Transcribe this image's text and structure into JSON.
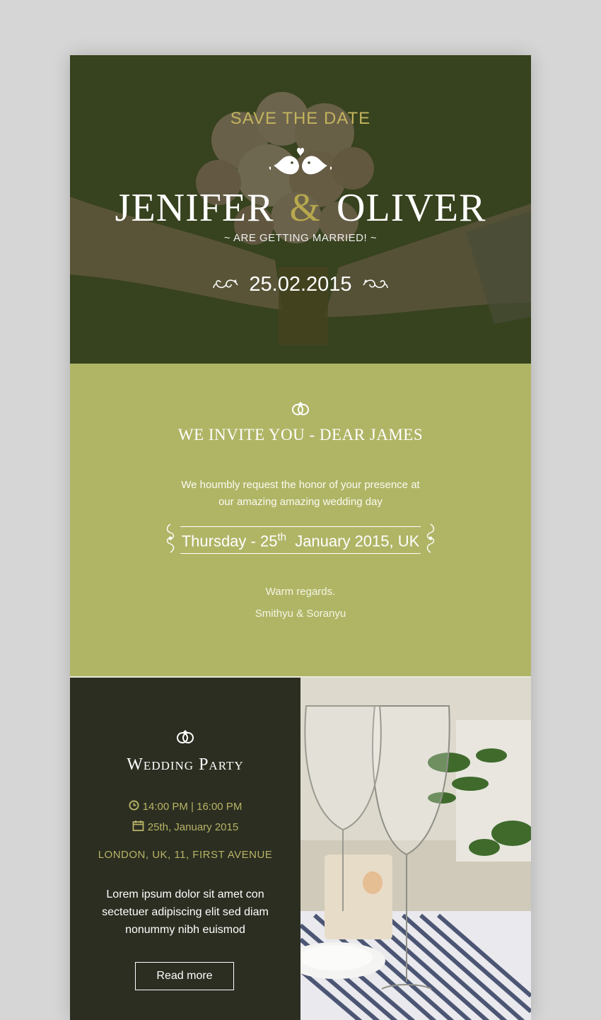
{
  "hero": {
    "save_the_date": "SAVE THE DATE",
    "bride": "JENIFER",
    "ampersand": "&",
    "groom": "OLIVER",
    "subtitle": "~ ARE GETTING MARRIED! ~",
    "date": "25.02.2015",
    "accent_color": "#c3b35e"
  },
  "invite": {
    "title": "WE INVITE YOU - DEAR JAMES",
    "text_line1": "We houmbly request the honor of your presence at",
    "text_line2": "our amazing amazing wedding day",
    "when_prefix": "Thursday -  25",
    "when_sup": "th",
    "when_suffix": "January 2015, UK",
    "regards": "Warm regards.",
    "signature": "Smithyu & Soranyu",
    "bg_color": "#b0b566"
  },
  "party": {
    "title": "Wedding Party",
    "time": "14:00 PM | 16:00 PM",
    "date": "25th, January 2015",
    "location": "LONDON, UK, 11, FIRST AVENUE",
    "description": "Lorem ipsum dolor sit amet con sectetuer adipiscing elit sed diam nonummy nibh euismod",
    "button": "Read more",
    "bg_color": "#2b2e21",
    "accent_color": "#b8b365"
  }
}
